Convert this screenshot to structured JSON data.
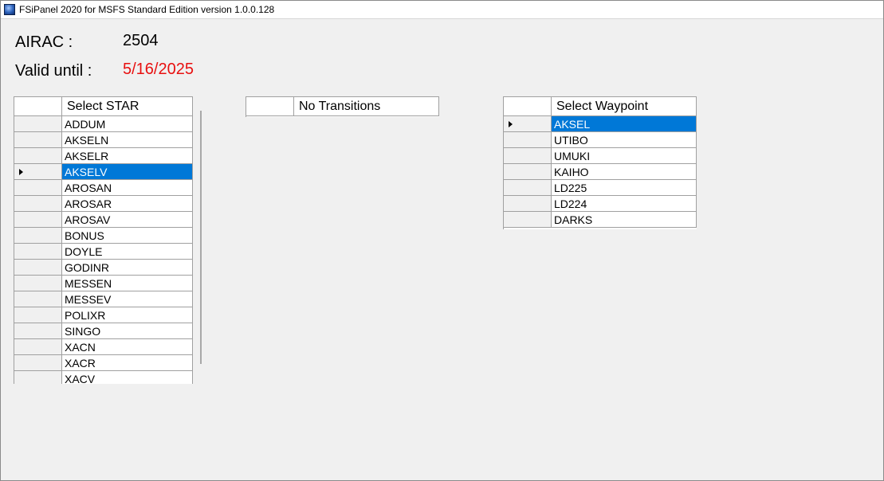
{
  "window": {
    "title": "FSiPanel 2020 for MSFS Standard Edition version 1.0.0.128",
    "icon": "fsipanel-app-icon"
  },
  "airac": {
    "label": "AIRAC :",
    "value": "2504"
  },
  "valid": {
    "label": "Valid until :",
    "value": "5/16/2025",
    "color": "#e81010"
  },
  "star_grid": {
    "header": "Select STAR",
    "selected_index": 3,
    "items": [
      "ADDUM",
      "AKSELN",
      "AKSELR",
      "AKSELV",
      "AROSAN",
      "AROSAR",
      "AROSAV",
      "BONUS",
      "DOYLE",
      "GODINR",
      "MESSEN",
      "MESSEV",
      "POLIXR",
      "SINGO",
      "XACN",
      "XACR",
      "XACV"
    ]
  },
  "transition_grid": {
    "header": "No Transitions",
    "items": []
  },
  "waypoint_grid": {
    "header": "Select Waypoint",
    "selected_index": 0,
    "items": [
      "AKSEL",
      "UTIBO",
      "UMUKI",
      "KAIHO",
      "LD225",
      "LD224",
      "DARKS"
    ]
  },
  "colors": {
    "selection": "#0078d7",
    "background": "#f0f0f0"
  }
}
